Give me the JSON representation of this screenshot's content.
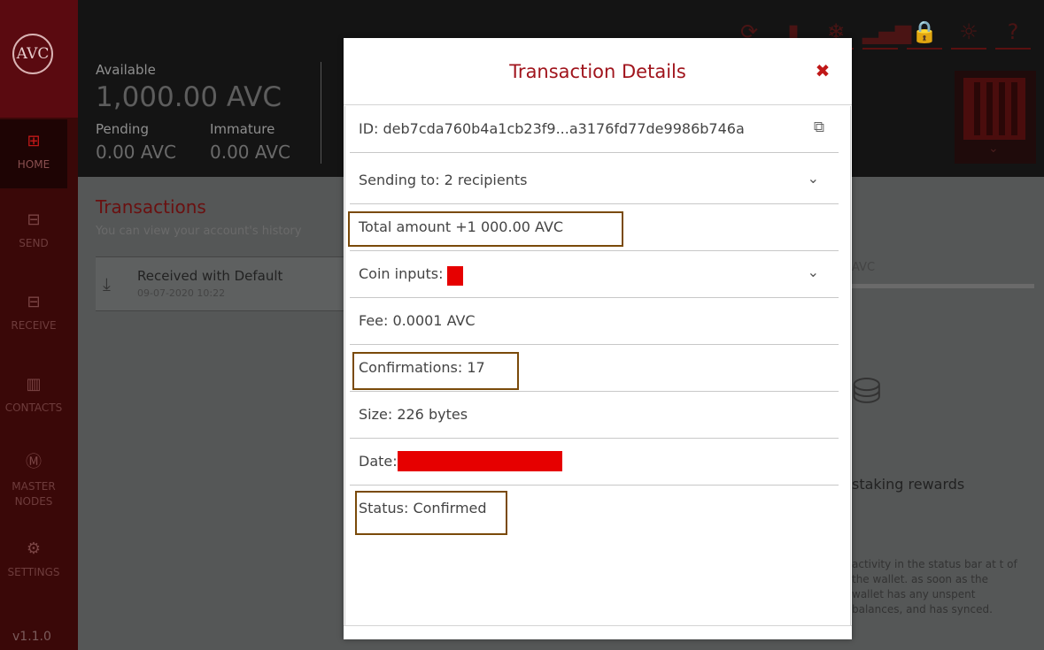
{
  "sidebar": {
    "logo": "AVC",
    "items": [
      {
        "label": "HOME",
        "icon": "home-icon"
      },
      {
        "label": "SEND",
        "icon": "send-icon"
      },
      {
        "label": "RECEIVE",
        "icon": "receive-icon"
      },
      {
        "label": "CONTACTS",
        "icon": "contacts-icon"
      },
      {
        "label": "MASTER NODES",
        "icon": "masternodes-icon"
      },
      {
        "label": "SETTINGS",
        "icon": "settings-icon"
      }
    ],
    "version": "v1.1.0"
  },
  "header": {
    "available_label": "Available",
    "available_value": "1,000.00 AVC",
    "pending_label": "Pending",
    "pending_value": "0.00 AVC",
    "immature_label": "Immature",
    "immature_value": "0.00 AVC",
    "top_icons": [
      "refresh-icon",
      "database-icon",
      "snowflake-icon",
      "signal-icon",
      "lock-icon",
      "sun-icon",
      "help-icon"
    ]
  },
  "transactions": {
    "title": "Transactions",
    "subtitle": "You can view your account's history",
    "items": [
      {
        "label": "Received with Default",
        "date": "09-07-2020 10:22"
      }
    ]
  },
  "right_panel": {
    "tab_label": "AVC",
    "title": "staking rewards",
    "text": "activity in the status bar at t of the wallet. as soon as the wallet has any unspent balances, and has synced."
  },
  "modal": {
    "title": "Transaction Details",
    "rows": {
      "id": "ID: deb7cda760b4a1cb23f9...a3176fd77de9986b746a",
      "sending_to": "Sending to: 2 recipients",
      "total_amount": "Total amount +1 000.00 AVC",
      "coin_inputs": "Coin inputs:",
      "fee": "Fee: 0.0001 AVC",
      "confirmations": "Confirmations: 17",
      "size": "Size: 226 bytes",
      "date": "Date:",
      "status": "Status: Confirmed"
    }
  },
  "colors": {
    "accent": "#a0141c",
    "redaction": "#e60000",
    "highlight": "#7a4a0a"
  }
}
